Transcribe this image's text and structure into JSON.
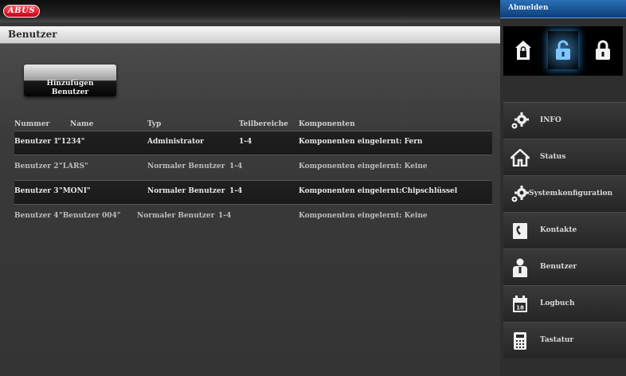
{
  "header": {
    "logo_text": "ABUS",
    "page_title": "Benutzer"
  },
  "main": {
    "add_button_label": "Hinzufügen\nBenutzer",
    "columns": [
      "Nummer",
      "Name",
      "Typ",
      "Teilbereiche",
      "Komponenten"
    ],
    "users": [
      {
        "num": "Benutzer 1",
        "name": "\"1234\"",
        "typ": "Administrator",
        "tb": "1-4",
        "comp": "Komponenten eingelernt: Fern"
      },
      {
        "num": "Benutzer 2",
        "name": "\"LARS\"",
        "typ": "Normaler Benutzer",
        "tb": "1-4",
        "comp": "Komponenten eingelernt: Keine"
      },
      {
        "num": "Benutzer 3",
        "name": "\"MONI\"",
        "typ": "Normaler Benutzer",
        "tb": "1-4",
        "comp": "Komponenten eingelernt:Chipschlüssel"
      },
      {
        "num": "Benutzer 4",
        "name": "\"Benutzer 004\"",
        "typ": "Normaler Benutzer",
        "tb": "1-4",
        "comp": "Komponenten eingelernt: Keine"
      }
    ]
  },
  "sidebar": {
    "logout_label": "Abmelden",
    "arm_buttons": [
      {
        "icon": "home-lock-icon",
        "active": false
      },
      {
        "icon": "unlocked-icon",
        "active": true
      },
      {
        "icon": "locked-icon",
        "active": false
      }
    ],
    "menu": [
      {
        "label": "INFO",
        "icon": "gears-icon"
      },
      {
        "label": "Status",
        "icon": "house-icon"
      },
      {
        "label": "Systemkonfiguration",
        "icon": "gears-icon"
      },
      {
        "label": "Kontakte",
        "icon": "phone-book-icon"
      },
      {
        "label": "Benutzer",
        "icon": "user-icon"
      },
      {
        "label": "Logbuch",
        "icon": "calendar-icon"
      },
      {
        "label": "Tastatur",
        "icon": "keypad-icon"
      }
    ]
  },
  "colors": {
    "accent_blue": "#2a6fb5",
    "logo_red": "#d4001a"
  }
}
